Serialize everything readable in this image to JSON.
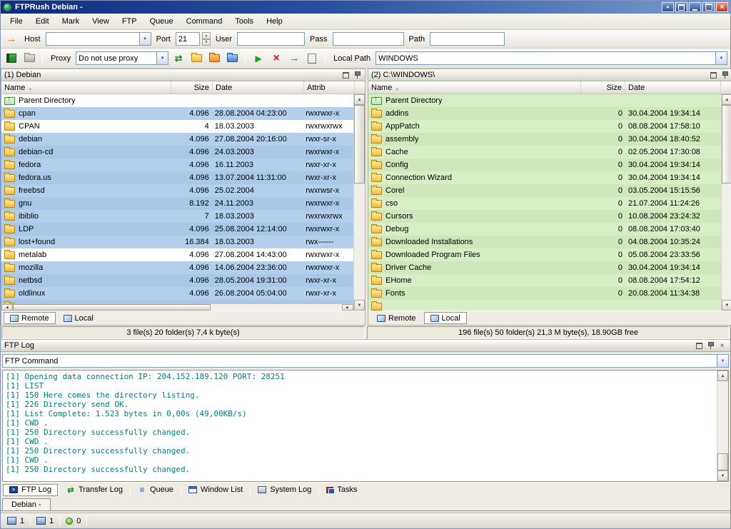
{
  "window": {
    "title": "FTPRush  Debian -"
  },
  "menu": {
    "items": [
      "File",
      "Edit",
      "Mark",
      "View",
      "FTP",
      "Queue",
      "Command",
      "Tools",
      "Help"
    ]
  },
  "connect_bar": {
    "host_label": "Host",
    "host_value": "",
    "port_label": "Port",
    "port_value": "21",
    "user_label": "User",
    "user_value": "",
    "pass_label": "Pass",
    "pass_value": "",
    "path_label": "Path",
    "path_value": ""
  },
  "proxy_bar": {
    "proxy_label": "Proxy",
    "proxy_value": "Do not use proxy",
    "local_path_label": "Local Path",
    "local_path_value": "WINDOWS"
  },
  "colors": {
    "marked_remote_row": "#b2cfeb",
    "marked_local_row": "#d8eec6",
    "log_text": "#008080"
  },
  "left_panel": {
    "caption": "(1) Debian",
    "columns": [
      "Name",
      "Size",
      "Date",
      "Attrib"
    ],
    "tabs": [
      "Remote",
      "Local"
    ],
    "active_tab": "Remote",
    "status": "3 file(s) 20 folder(s) 7,4 k byte(s)",
    "rows": [
      {
        "name": "Parent Directory",
        "size": "",
        "date": "",
        "attrib": "",
        "hl": false,
        "parent": true
      },
      {
        "name": "cpan",
        "size": "4.096",
        "date": "28.08.2004 04:23:00",
        "attrib": "rwxrwxr-x",
        "hl": true
      },
      {
        "name": "CPAN",
        "size": "4",
        "date": "18.03.2003",
        "attrib": "rwxrwxrwx",
        "hl": false
      },
      {
        "name": "debian",
        "size": "4.096",
        "date": "27.08.2004 20:16:00",
        "attrib": "rwxr-sr-x",
        "hl": true
      },
      {
        "name": "debian-cd",
        "size": "4.096",
        "date": "24.03.2003",
        "attrib": "rwxrwxr-x",
        "hl": true
      },
      {
        "name": "fedora",
        "size": "4.096",
        "date": "16.11.2003",
        "attrib": "rwxr-xr-x",
        "hl": true
      },
      {
        "name": "fedora.us",
        "size": "4.096",
        "date": "13.07.2004 11:31:00",
        "attrib": "rwxr-xr-x",
        "hl": true
      },
      {
        "name": "freebsd",
        "size": "4.096",
        "date": "25.02.2004",
        "attrib": "rwxrwsr-x",
        "hl": true
      },
      {
        "name": "gnu",
        "size": "8.192",
        "date": "24.11.2003",
        "attrib": "rwxrwxr-x",
        "hl": true
      },
      {
        "name": "ibiblio",
        "size": "7",
        "date": "18.03.2003",
        "attrib": "rwxrwxrwx",
        "hl": true
      },
      {
        "name": "LDP",
        "size": "4.096",
        "date": "25.08.2004 12:14:00",
        "attrib": "rwxrwxr-x",
        "hl": true
      },
      {
        "name": "lost+found",
        "size": "16.384",
        "date": "18.03.2003",
        "attrib": "rwx------",
        "hl": true
      },
      {
        "name": "metalab",
        "size": "4.096",
        "date": "27.08.2004 14:43:00",
        "attrib": "rwxrwxr-x",
        "hl": false
      },
      {
        "name": "mozilla",
        "size": "4.096",
        "date": "14.06.2004 23:36:00",
        "attrib": "rwxrwxr-x",
        "hl": true
      },
      {
        "name": "netbsd",
        "size": "4.096",
        "date": "28.05.2004 19:31:00",
        "attrib": "rwxr-xr-x",
        "hl": true
      },
      {
        "name": "oldlinux",
        "size": "4.096",
        "date": "26.08.2004 05:04:00",
        "attrib": "rwxr-xr-x",
        "hl": true
      },
      {
        "name": "",
        "size": "",
        "date": "",
        "attrib": "",
        "hl": true
      }
    ]
  },
  "right_panel": {
    "caption": "(2) C:\\WINDOWS\\",
    "columns": [
      "Name",
      "Size",
      "Date"
    ],
    "tabs": [
      "Remote",
      "Local"
    ],
    "active_tab": "Local",
    "status": "196 file(s) 50 folder(s) 21,3 M byte(s), 18.90GB free",
    "rows": [
      {
        "name": "Parent Directory",
        "size": "",
        "date": "",
        "hl": true,
        "parent": true
      },
      {
        "name": "addins",
        "size": "0",
        "date": "30.04.2004 19:34:14",
        "hl": true
      },
      {
        "name": "AppPatch",
        "size": "0",
        "date": "08.08.2004 17:58:10",
        "hl": true
      },
      {
        "name": "assembly",
        "size": "0",
        "date": "30.04.2004 18:40:52",
        "hl": true
      },
      {
        "name": "Cache",
        "size": "0",
        "date": "02.05.2004 17:30:08",
        "hl": true
      },
      {
        "name": "Config",
        "size": "0",
        "date": "30.04.2004 19:34:14",
        "hl": true
      },
      {
        "name": "Connection Wizard",
        "size": "0",
        "date": "30.04.2004 19:34:14",
        "hl": true
      },
      {
        "name": "Corel",
        "size": "0",
        "date": "03.05.2004 15:15:56",
        "hl": true
      },
      {
        "name": "cso",
        "size": "0",
        "date": "21.07.2004 11:24:26",
        "hl": true
      },
      {
        "name": "Cursors",
        "size": "0",
        "date": "10.08.2004 23:24:32",
        "hl": true
      },
      {
        "name": "Debug",
        "size": "0",
        "date": "08.08.2004 17:03:40",
        "hl": true
      },
      {
        "name": "Downloaded Installations",
        "size": "0",
        "date": "04.08.2004 10:35:24",
        "hl": true
      },
      {
        "name": "Downloaded Program Files",
        "size": "0",
        "date": "05.08.2004 23:33:56",
        "hl": true
      },
      {
        "name": "Driver Cache",
        "size": "0",
        "date": "30.04.2004 19:34:14",
        "hl": true
      },
      {
        "name": "EHome",
        "size": "0",
        "date": "08.08.2004 17:54:12",
        "hl": true
      },
      {
        "name": "Fonts",
        "size": "0",
        "date": "20.08.2004 11:34:38",
        "hl": true
      },
      {
        "name": "",
        "size": "",
        "date": "",
        "hl": true
      }
    ]
  },
  "log_panel": {
    "caption": "FTP Log",
    "command_combo": "FTP Command",
    "lines": [
      "[1] Opening data connection IP: 204.152.189.120 PORT: 28251",
      "[1] LIST",
      "[1] 150 Here comes the directory listing.",
      "[1] 226 Directory send OK.",
      "[1] List Complete: 1.523 bytes in 0,00s (49,00KB/s)",
      "[1] CWD .",
      "[1] 250 Directory successfully changed.",
      "[1] CWD .",
      "[1] 250 Directory successfully changed.",
      "[1] CWD .",
      "[1] 250 Directory successfully changed."
    ]
  },
  "bottom_tabs": {
    "active": "FTP Log",
    "tabs": [
      {
        "label": "FTP Log",
        "icon": "ftp-log"
      },
      {
        "label": "Transfer Log",
        "icon": "transfer-log"
      },
      {
        "label": "Queue",
        "icon": "queue"
      },
      {
        "label": "Window List",
        "icon": "window-list"
      },
      {
        "label": "System Log",
        "icon": "system-log"
      },
      {
        "label": "Tasks",
        "icon": "tasks"
      }
    ]
  },
  "session_tabs": {
    "active": "Debian -",
    "tabs": [
      "Debian -"
    ]
  },
  "statusbar": {
    "items": [
      {
        "icon": "connection",
        "value": "1"
      },
      {
        "icon": "window",
        "value": "1"
      },
      {
        "icon": "queue",
        "value": "0"
      }
    ]
  }
}
